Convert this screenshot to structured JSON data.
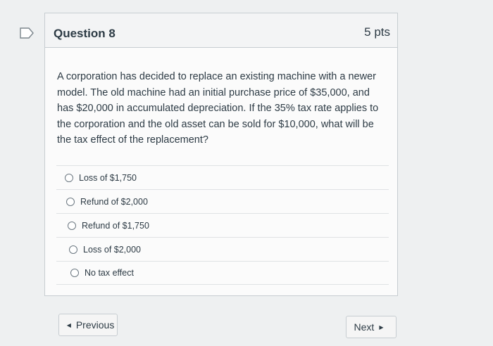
{
  "question": {
    "title": "Question 8",
    "points": "5 pts",
    "text": "A corporation has decided to replace an existing machine with a newer model. The old machine had an initial purchase price of $35,000, and has $20,000 in accumulated depreciation. If the 35% tax rate applies to the corporation and the old asset can be sold for $10,000, what will be the tax effect of the replacement?",
    "answers": [
      {
        "label": "Loss of $1,750"
      },
      {
        "label": "Refund of $2,000"
      },
      {
        "label": "Refund of $1,750"
      },
      {
        "label": "Loss of $2,000"
      },
      {
        "label": "No tax effect"
      }
    ]
  },
  "navigation": {
    "previous_label": "Previous",
    "next_label": "Next",
    "previous_icon": "chevron-left-icon",
    "next_icon": "chevron-right-icon"
  },
  "icons": {
    "flag": "flag-icon"
  },
  "colors": {
    "background": "#eef0f1",
    "text": "#2d3b45",
    "border": "#c7cdd1"
  }
}
